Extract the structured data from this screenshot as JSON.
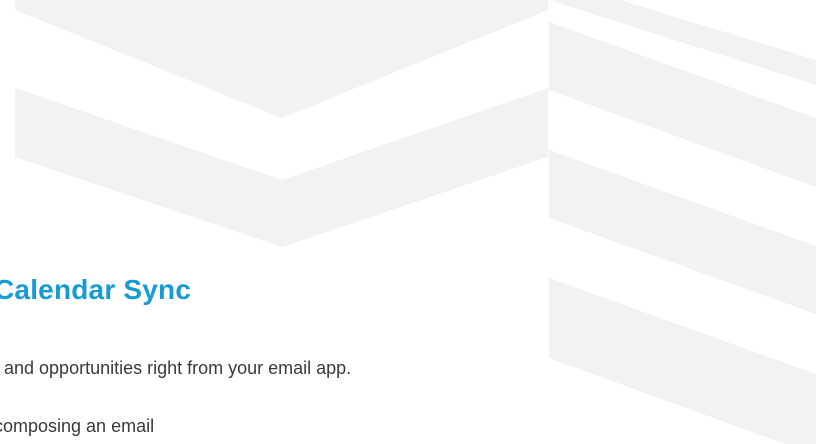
{
  "colors": {
    "accent": "#169bd5",
    "background": "#ffffff",
    "pattern": "#f2f2f2",
    "text": "#3a3a3a"
  },
  "hero": {
    "title": "Calendar Sync",
    "subtitle": ", and opportunities right from your email app.",
    "cutoff_text": "composing an email"
  }
}
